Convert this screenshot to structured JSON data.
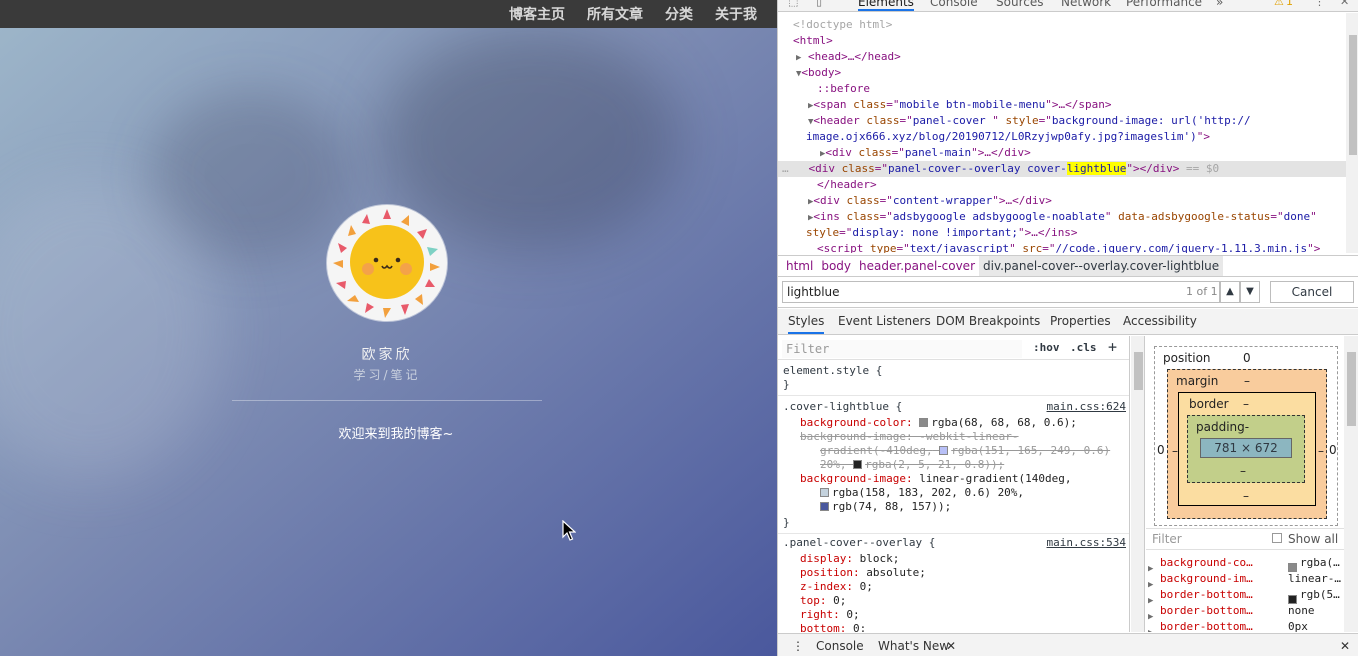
{
  "blog": {
    "nav": [
      "博客主页",
      "所有文章",
      "分类",
      "关于我"
    ],
    "author_name": "欧家欣",
    "author_subtitle": "学习/笔记",
    "welcome": "欢迎来到我的博客~"
  },
  "devtools": {
    "tabs": [
      "Elements",
      "Console",
      "Sources",
      "Network",
      "Performance"
    ],
    "more_tabs": "»",
    "warning_count": "1",
    "dom": {
      "doctype": "<!doctype html>",
      "html": "<html>",
      "head": "<head>…</head>",
      "body": "<body>",
      "before": "::before",
      "span_class": "mobile btn-mobile-menu",
      "header_class": "panel-cover ",
      "header_style_1": "background-image: url('http://",
      "header_style_2": "image.ojx666.xyz/blog/20190712/L0Rzyjwp0afy.jpg?imageslim')",
      "panel_main": "panel-main",
      "overlay_class_pre": "panel-cover--overlay cover-",
      "overlay_class_hl": "lightblue",
      "eq": "== $0",
      "header_close": "</header>",
      "content_wrapper": "content-wrapper",
      "ins_class": "adsbygoogle adsbygoogle-noablate",
      "ins_status_attr": "data-adsbygoogle-status",
      "ins_status": "done",
      "ins_style": "display: none !important;",
      "script_type": "text/javascript",
      "script_src": "//code.jquery.com/jquery-1.11.3.min.js"
    },
    "breadcrumb": [
      "html",
      "body",
      "header.panel-cover",
      "div.panel-cover--overlay.cover-lightblue"
    ],
    "search": {
      "value": "lightblue",
      "count": "1 of 1",
      "cancel": "Cancel"
    },
    "subtabs": [
      "Styles",
      "Event Listeners",
      "DOM Breakpoints",
      "Properties",
      "Accessibility"
    ],
    "styles": {
      "filter_placeholder": "Filter",
      "hov": ":hov",
      "cls": ".cls",
      "element_style": "element.style {",
      "rule1_selector": ".cover-lightblue {",
      "rule1_src": "main.css:624",
      "rule1_bg_color": "background-color:",
      "rule1_bg_color_val": "rgba(68, 68, 68, 0.6);",
      "rule1_bg_img_old1": "background-image: -webkit-linear-",
      "rule1_bg_img_old2": "gradient(-410deg,",
      "rule1_bg_img_old2b": "rgba(151, 165, 249, 0.6)",
      "rule1_bg_img_old3": "20%,",
      "rule1_bg_img_old3b": "rgba(2, 5, 21, 0.8));",
      "rule1_bg_img": "background-image:",
      "rule1_bg_img_val": "linear-gradient(140deg,",
      "rule1_stop1": "rgba(158, 183, 202, 0.6) 20%,",
      "rule1_stop2": "rgb(74, 88, 157));",
      "rule2_selector": ".panel-cover--overlay {",
      "rule2_src": "main.css:534",
      "rule2_props": [
        [
          "display:",
          "block;"
        ],
        [
          "position:",
          "absolute;"
        ],
        [
          "z-index:",
          "0;"
        ],
        [
          "top:",
          "0;"
        ],
        [
          "right:",
          "0;"
        ],
        [
          "bottom:",
          "0;"
        ]
      ],
      "close": "}"
    },
    "computed": {
      "position_label": "position",
      "position_val": "0",
      "margin_label": "margin",
      "border_label": "border",
      "padding_label": "padding-",
      "content_size": "781 × 672",
      "dash": "–",
      "zero": "0",
      "filter_placeholder": "Filter",
      "show_all": "Show all",
      "rows": [
        [
          "background-co…",
          "rgba(…"
        ],
        [
          "background-im…",
          "linear-…"
        ],
        [
          "border-bottom…",
          "rgb(5…"
        ],
        [
          "border-bottom…",
          "none"
        ],
        [
          "border-bottom…",
          "0px"
        ]
      ]
    },
    "drawer": [
      "Console",
      "What's New"
    ],
    "colors": {
      "swatch_gray": "#8a8a8a",
      "swatch_violet": "#b8c0f7",
      "swatch_black": "#222",
      "swatch_light": "#c4d2dd",
      "swatch_navy": "#4a589d"
    }
  }
}
